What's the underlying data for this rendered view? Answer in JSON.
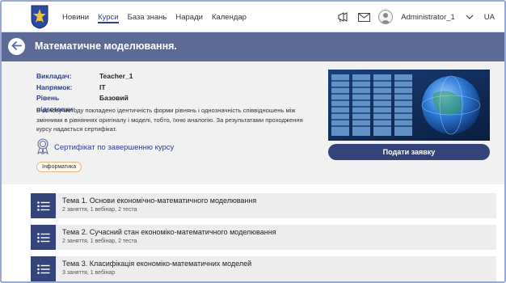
{
  "nav": {
    "items": [
      {
        "label": "Новини"
      },
      {
        "label": "Курси"
      },
      {
        "label": "База знань"
      },
      {
        "label": "Наради"
      },
      {
        "label": "Календар"
      }
    ],
    "active_index": 1
  },
  "user": {
    "name": "Administrator_1",
    "lang": "UA"
  },
  "icons": {
    "logo": "kyiv-coat-of-arms-icon",
    "notifications": "megaphone-icon",
    "messages": "envelope-icon",
    "avatar": "user-avatar-icon",
    "dropdown": "chevron-down-icon",
    "back": "arrow-left-icon",
    "certificate": "certificate-badge-icon",
    "topic": "list-icon"
  },
  "course": {
    "title": "Математичне моделювання.",
    "teacher_label": "Викладач:",
    "teacher": "Teacher_1",
    "direction_label": "Напрямок:",
    "direction": "IT",
    "level_label": "Рівень підготовки:",
    "level": "Базовий",
    "description": "В основу методу покладено ідентичність форми рівнянь і однозначність співвідношень між змінними в рівняннях оригіналу і моделі, тобто, їхню аналогію. За результатами проходження курсу надається сертифікат.",
    "certificate_text": "Сертифікат по завершенню курсу",
    "tag": "Інформатика",
    "apply_label": "Подати заявку"
  },
  "topics": [
    {
      "title": "Тема 1. Основи економічно-математичного моделювання",
      "sub": "2 заняття, 1 вебінар, 2 теста"
    },
    {
      "title": "Тема 2. Сучасний стан економіко-математичного моделювання",
      "sub": "2 заняття, 1 вебінар, 2 теста"
    },
    {
      "title": "Тема 3. Класифікація економіко-математичних моделей",
      "sub": "3 заняття, 1 вебінар"
    }
  ],
  "colors": {
    "accent": "#2d3f8c",
    "header_band": "#5d6a95",
    "button": "#34447a",
    "tag_border": "#e1b87a"
  }
}
